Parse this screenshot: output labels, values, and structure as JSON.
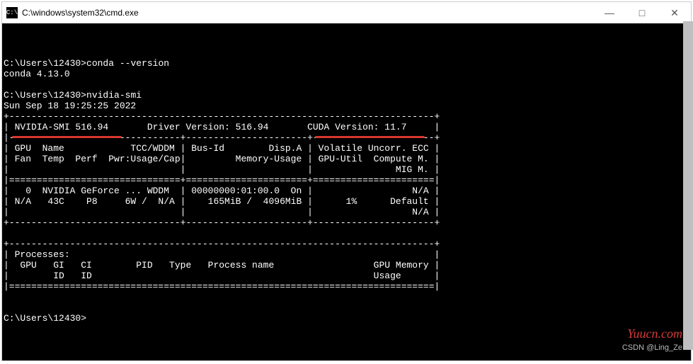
{
  "titlebar": {
    "icon_label": "C:\\",
    "title": "C:\\windows\\system32\\cmd.exe",
    "min": "—",
    "max": "□",
    "close": "✕"
  },
  "prompt1": "C:\\Users\\12430>",
  "cmd1": "conda --version",
  "out1": "conda 4.13.0",
  "prompt2": "C:\\Users\\12430>",
  "cmd2": "nvidia-smi",
  "smi_date": "Sun Sep 18 19:25:25 2022",
  "line_top": "+-----------------------------------------------------------------------------+",
  "smi_row1": "| NVIDIA-SMI 516.94       Driver Version: 516.94       CUDA Version: 11.7     |",
  "line_sep1": "|-------------------------------+----------------------+----------------------+",
  "hdr_r1": "| GPU  Name            TCC/WDDM | Bus-Id        Disp.A | Volatile Uncorr. ECC |",
  "hdr_r2": "| Fan  Temp  Perf  Pwr:Usage/Cap|         Memory-Usage | GPU-Util  Compute M. |",
  "hdr_r3": "|                               |                      |               MIG M. |",
  "line_sep2": "|===============================+======================+======================|",
  "gpu_r1": "|   0  NVIDIA GeForce ... WDDM  | 00000000:01:00.0  On |                  N/A |",
  "gpu_r2": "| N/A   43C    P8     6W /  N/A |    165MiB /  4096MiB |      1%      Default |",
  "gpu_r3": "|                               |                      |                  N/A |",
  "line_sep3": "+-------------------------------+----------------------+----------------------+",
  "proc_top": "+-----------------------------------------------------------------------------+",
  "proc_hdr": "| Processes:                                                                  |",
  "proc_r2": "|  GPU   GI   CI        PID   Type   Process name                  GPU Memory |",
  "proc_r3": "|        ID   ID                                                   Usage      |",
  "proc_sep": "|=============================================================================|",
  "prompt3": "C:\\Users\\12430>",
  "watermark1": "Yuucn.com",
  "watermark2": "CSDN @Ling_Ze"
}
